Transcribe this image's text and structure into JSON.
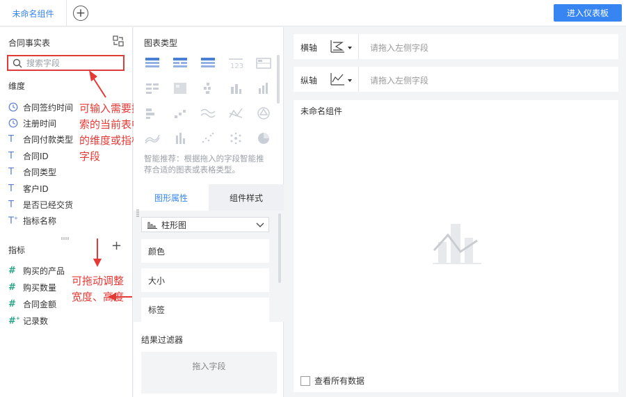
{
  "topbar": {
    "active_tab": "未命名组件",
    "enter_dashboard": "进入仪表板"
  },
  "left": {
    "title": "合同事实表",
    "search_placeholder": "搜索字段",
    "dimension_title": "维度",
    "dimensions": [
      {
        "label": "合同签约时间",
        "icon": "clock-icon"
      },
      {
        "label": "注册时间",
        "icon": "clock-icon"
      },
      {
        "label": "合同付款类型",
        "icon": "text-type-icon"
      },
      {
        "label": "合同ID",
        "icon": "text-type-icon"
      },
      {
        "label": "合同类型",
        "icon": "text-type-icon"
      },
      {
        "label": "客户ID",
        "icon": "text-type-icon"
      },
      {
        "label": "是否已经交货",
        "icon": "text-type-icon"
      },
      {
        "label": "指标名称",
        "icon": "text-calc-icon"
      }
    ],
    "measure_title": "指标",
    "measures": [
      {
        "label": "购买的产品",
        "icon": "hash-icon"
      },
      {
        "label": "购买数量",
        "icon": "hash-icon"
      },
      {
        "label": "合同金额",
        "icon": "hash-icon"
      },
      {
        "label": "记录数",
        "icon": "hash-calc-icon"
      }
    ]
  },
  "annotations": {
    "search_note": "可输入需要搜索的当前表中的维度或指标字段",
    "resize_note": "可拖动调整宽度、高度"
  },
  "middle": {
    "chart_type_title": "图表类型",
    "smart_tip": "智能推荐：根据拖入的字段智能推荐合适的图表或表格类型。",
    "tab_props": "图形属性",
    "tab_style": "组件样式",
    "chart_select": "柱形图",
    "props": [
      "颜色",
      "大小",
      "标签"
    ],
    "filter_title": "结果过滤器",
    "filter_drop": "拖入字段"
  },
  "right": {
    "x_axis_label": "横轴",
    "y_axis_label": "纵轴",
    "drop_hint": "请拖入左侧字段",
    "canvas_title": "未命名组件",
    "view_all": "查看所有数据"
  },
  "colors": {
    "accent": "#3685f2",
    "annotation": "#e53935",
    "chart_icon_active": "#4a7fd6",
    "chart_icon_muted": "#c9ced6"
  }
}
